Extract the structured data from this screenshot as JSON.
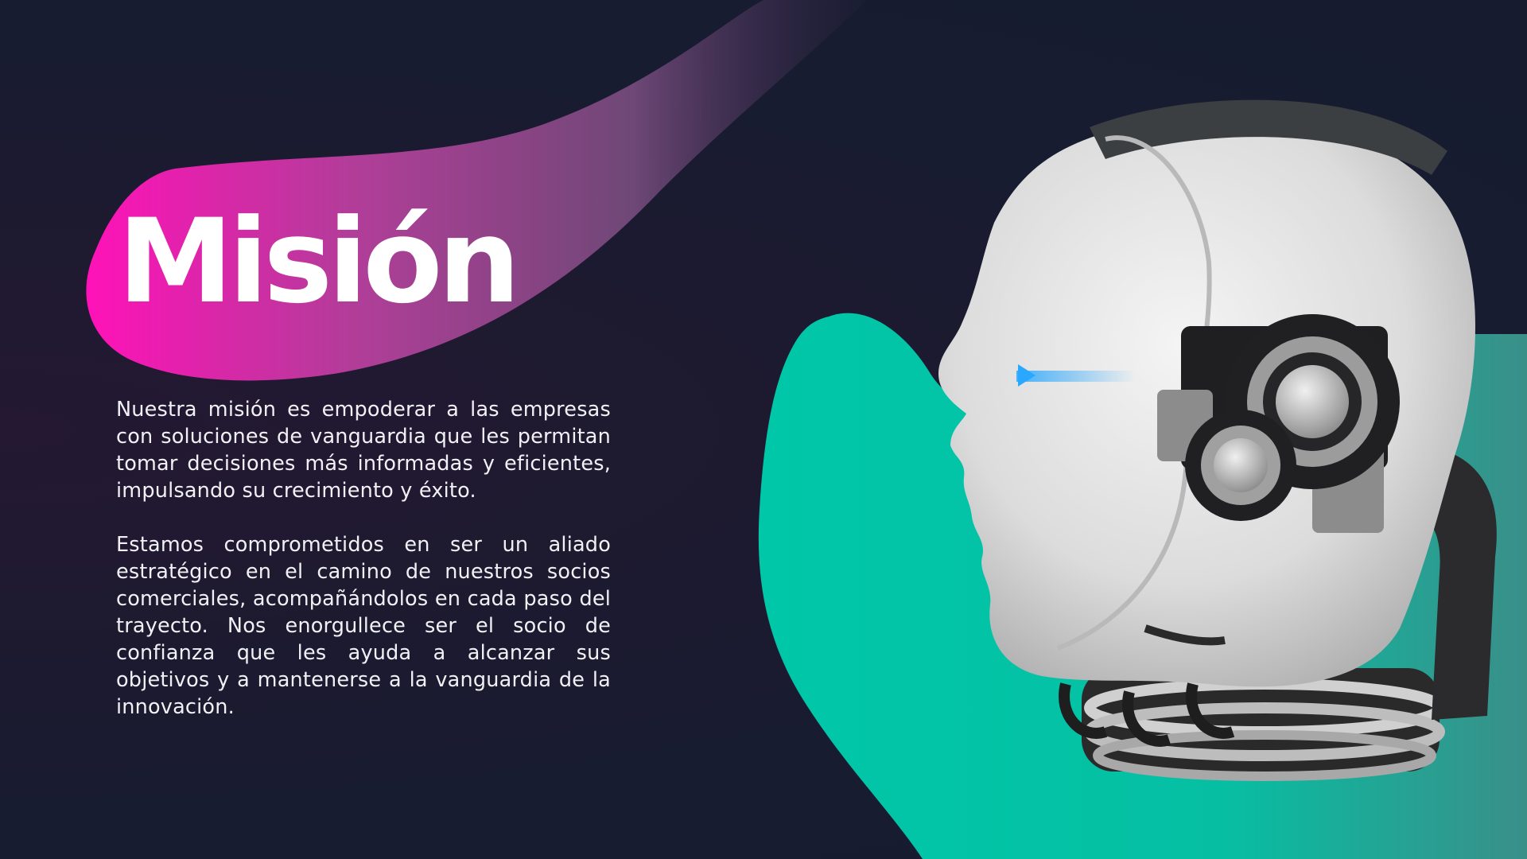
{
  "slide": {
    "title": "Misión",
    "paragraphs": [
      "Nuestra misión es empoderar a las empresas con soluciones de vanguardia que les permitan tomar decisiones más informadas y eficientes, impulsando su crecimiento y éxito.",
      "Estamos comprometidos en ser un aliado estratégico en el camino de nuestros socios comerciales, acompañándolos en cada paso del trayecto. Nos enorgullece ser el socio de confianza que les ayuda a alcanzar sus objetivos y a mantenerse a la vanguardia de la innovación."
    ],
    "image": {
      "icon": "robot-head-icon"
    }
  },
  "colors": {
    "background": "#1b1a30",
    "magenta": "#f214b4",
    "purple": "#7a4d86",
    "teal": "#00c3a6",
    "text": "#ffffff"
  }
}
